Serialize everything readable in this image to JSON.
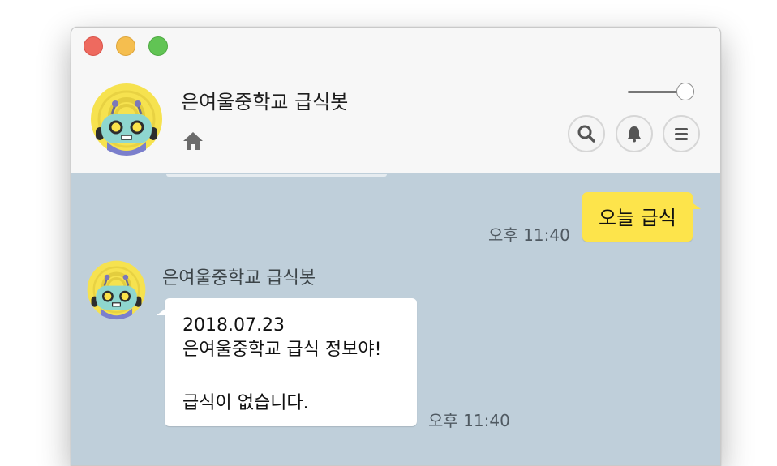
{
  "window": {
    "traffic_lights": [
      "close",
      "minimize",
      "zoom"
    ]
  },
  "header": {
    "title": "은여울중학교 급식봇",
    "home_icon": "home-icon",
    "opacity_slider_value": 1.0,
    "buttons": [
      {
        "icon": "search-icon"
      },
      {
        "icon": "bell-icon"
      },
      {
        "icon": "menu-icon"
      }
    ]
  },
  "chat": {
    "outgoing": {
      "text": "오늘 급식",
      "time": "오후 11:40"
    },
    "incoming": {
      "sender": "은여울중학교 급식봇",
      "lines": [
        "2018.07.23",
        "은여울중학교 급식 정보야!",
        "급식이 없습니다."
      ],
      "time": "오후 11:40"
    }
  },
  "colors": {
    "chat_background": "#bfcfda",
    "my_bubble": "#fde44b",
    "bot_bubble": "#ffffff",
    "header_background": "#f7f7f7"
  }
}
